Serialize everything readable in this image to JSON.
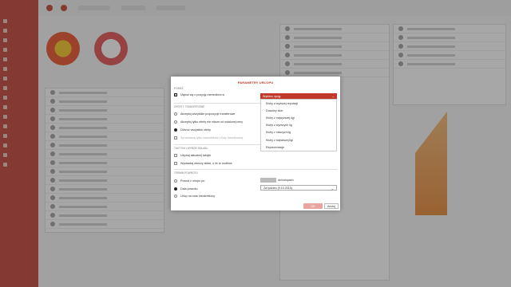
{
  "modal": {
    "title": "PARAMETRY URLOPU",
    "section_general": "POBIEŻ",
    "opt_assistant": "Uiększ się o pozycję menedżera w",
    "section_offers": "OFERTY TRANSFEROWE",
    "offer_options": [
      "Akceptuj wszystkie propozycje transferowe",
      "Akceptuj tylko oferty nie niższe od ustalonej ceny",
      "Odrzuć wszystkie oferty",
      "Sprzedawaj tylko zawodników z listy transferowej"
    ],
    "section_tactics": "TAKTYKA I WYBÓR SKŁADU",
    "tactic_options": [
      "Używaj aktualnej taktyki",
      "Wystawiaj obecny skład, o ile to możliwe"
    ],
    "section_return": "TERMIN POWROTU",
    "return_options": [
      "Powrót z urlopu po:",
      "Data powrotu:",
      "Urlop na czas nieokreślony"
    ],
    "dropdown_selected": "Wybierz opcję",
    "dropdown_options": [
      "Kluby o wyższej reputacji",
      "Dowolny klub",
      "Kluby z najwyższej ligi",
      "Kluby z wyższych lig",
      "Kluby z niższych lig",
      "Kluby z najniższej ligi",
      "Reprezentacje"
    ],
    "months_label": "dni/urlopach",
    "return_date": "Za tydzień (9.10.2015)",
    "ok_label": "OK",
    "cancel_label": "Anuluj"
  },
  "colors": {
    "accent": "#c0392b",
    "overlay": "rgba(60,60,60,0.45)"
  }
}
